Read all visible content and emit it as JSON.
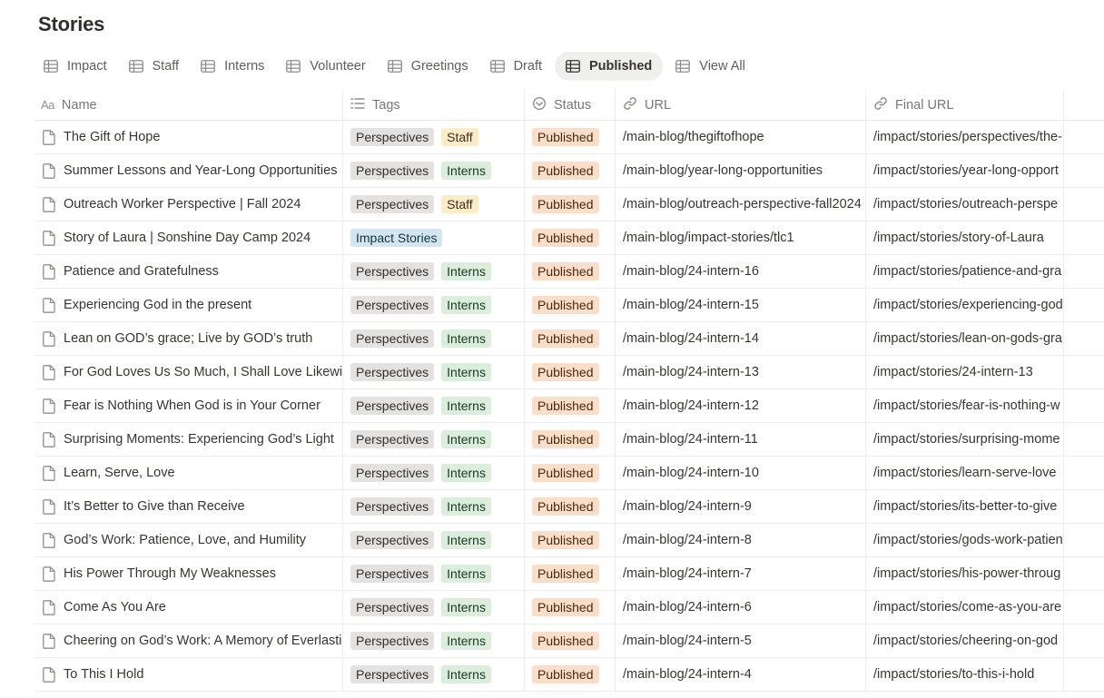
{
  "page": {
    "title": "Stories"
  },
  "tabs": [
    {
      "label": "Impact",
      "active": false
    },
    {
      "label": "Staff",
      "active": false
    },
    {
      "label": "Interns",
      "active": false
    },
    {
      "label": "Volunteer",
      "active": false
    },
    {
      "label": "Greetings",
      "active": false
    },
    {
      "label": "Draft",
      "active": false
    },
    {
      "label": "Published",
      "active": true
    },
    {
      "label": "View All",
      "active": false
    }
  ],
  "columns": {
    "name": {
      "icon": "Aa",
      "label": "Name"
    },
    "tags": {
      "icon": "list-icon",
      "label": "Tags"
    },
    "status": {
      "icon": "status-icon",
      "label": "Status"
    },
    "url": {
      "icon": "link-icon",
      "label": "URL"
    },
    "final_url": {
      "icon": "link-icon",
      "label": "Final URL"
    }
  },
  "tag_colors": {
    "Perspectives": "gray",
    "Staff": "yellow",
    "Interns": "green",
    "Impact Stories": "blue"
  },
  "rows": [
    {
      "name": "The Gift of Hope",
      "tags": [
        "Perspectives",
        "Staff"
      ],
      "status": "Published",
      "url": "/main-blog/thegiftofhope",
      "final_url": "/impact/stories/perspectives/the-"
    },
    {
      "name": "Summer Lessons and Year-Long Opportunities",
      "tags": [
        "Perspectives",
        "Interns"
      ],
      "status": "Published",
      "url": "/main-blog/year-long-opportunities",
      "final_url": "/impact/stories/year-long-opport"
    },
    {
      "name": "Outreach Worker Perspective | Fall 2024",
      "tags": [
        "Perspectives",
        "Staff"
      ],
      "status": "Published",
      "url": "/main-blog/outreach-perspective-fall2024",
      "final_url": "/impact/stories/outreach-perspe"
    },
    {
      "name": "Story of Laura | Sonshine Day Camp 2024",
      "tags": [
        "Impact Stories"
      ],
      "status": "Published",
      "url": "/main-blog/impact-stories/tlc1",
      "final_url": "/impact/stories/story-of-Laura"
    },
    {
      "name": "Patience and Gratefulness",
      "tags": [
        "Perspectives",
        "Interns"
      ],
      "status": "Published",
      "url": "/main-blog/24-intern-16",
      "final_url": "/impact/stories/patience-and-gra"
    },
    {
      "name": "Experiencing God in the present",
      "tags": [
        "Perspectives",
        "Interns"
      ],
      "status": "Published",
      "url": "/main-blog/24-intern-15",
      "final_url": "/impact/stories/experiencing-god"
    },
    {
      "name": "Lean on GOD’s grace; Live by GOD’s truth",
      "tags": [
        "Perspectives",
        "Interns"
      ],
      "status": "Published",
      "url": "/main-blog/24-intern-14",
      "final_url": "/impact/stories/lean-on-gods-gra"
    },
    {
      "name": "For God Loves Us So Much, I Shall Love Likewise",
      "tags": [
        "Perspectives",
        "Interns"
      ],
      "status": "Published",
      "url": "/main-blog/24-intern-13",
      "final_url": "/impact/stories/24-intern-13"
    },
    {
      "name": "Fear is Nothing When God is in Your Corner",
      "tags": [
        "Perspectives",
        "Interns"
      ],
      "status": "Published",
      "url": "/main-blog/24-intern-12",
      "final_url": "/impact/stories/fear-is-nothing-w"
    },
    {
      "name": "Surprising Moments: Experiencing God’s Light",
      "tags": [
        "Perspectives",
        "Interns"
      ],
      "status": "Published",
      "url": "/main-blog/24-intern-11",
      "final_url": "/impact/stories/surprising-mome"
    },
    {
      "name": "Learn, Serve, Love",
      "tags": [
        "Perspectives",
        "Interns"
      ],
      "status": "Published",
      "url": "/main-blog/24-intern-10",
      "final_url": "/impact/stories/learn-serve-love"
    },
    {
      "name": "It’s Better to Give than Receive",
      "tags": [
        "Perspectives",
        "Interns"
      ],
      "status": "Published",
      "url": "/main-blog/24-intern-9",
      "final_url": "/impact/stories/its-better-to-give"
    },
    {
      "name": "God’s Work: Patience, Love, and Humility",
      "tags": [
        "Perspectives",
        "Interns"
      ],
      "status": "Published",
      "url": "/main-blog/24-intern-8",
      "final_url": "/impact/stories/gods-work-patien"
    },
    {
      "name": "His Power Through My Weaknesses",
      "tags": [
        "Perspectives",
        "Interns"
      ],
      "status": "Published",
      "url": "/main-blog/24-intern-7",
      "final_url": "/impact/stories/his-power-throug"
    },
    {
      "name": "Come As You Are",
      "tags": [
        "Perspectives",
        "Interns"
      ],
      "status": "Published",
      "url": "/main-blog/24-intern-6",
      "final_url": "/impact/stories/come-as-you-are"
    },
    {
      "name": "Cheering on God’s Work: A Memory of Everlasting",
      "tags": [
        "Perspectives",
        "Interns"
      ],
      "status": "Published",
      "url": "/main-blog/24-intern-5",
      "final_url": "/impact/stories/cheering-on-god"
    },
    {
      "name": "To This I Hold",
      "tags": [
        "Perspectives",
        "Interns"
      ],
      "status": "Published",
      "url": "/main-blog/24-intern-4",
      "final_url": "/impact/stories/to-this-i-hold"
    }
  ]
}
